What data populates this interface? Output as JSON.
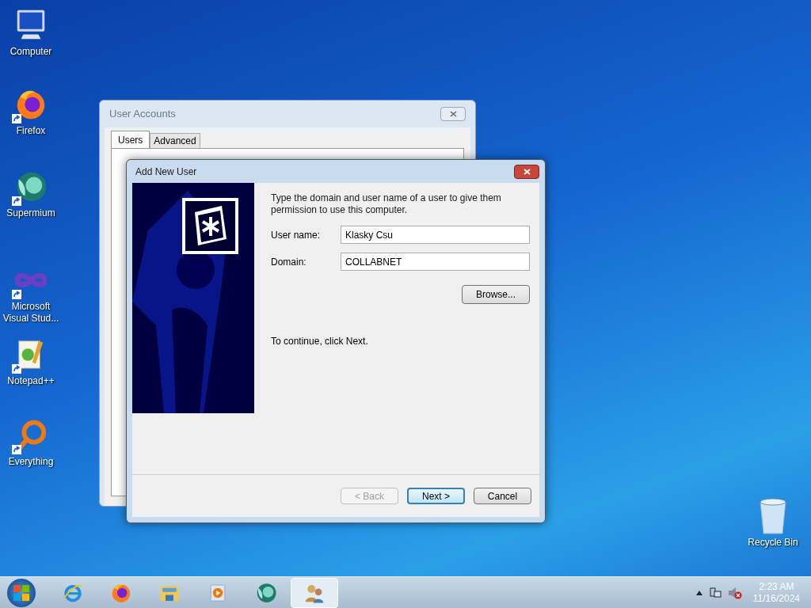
{
  "desktop_icons": [
    {
      "label": "Computer",
      "kind": "computer"
    },
    {
      "label": "Firefox",
      "kind": "firefox"
    },
    {
      "label": "Supermium",
      "kind": "supermium"
    },
    {
      "label": "Microsoft Visual Stud...",
      "kind": "visualstudio"
    },
    {
      "label": "Notepad++",
      "kind": "notepad"
    },
    {
      "label": "Everything",
      "kind": "everything"
    }
  ],
  "recycle_bin": {
    "label": "Recycle Bin"
  },
  "background_window": {
    "title": "User Accounts",
    "tabs": [
      {
        "label": "Users",
        "selected": true
      },
      {
        "label": "Advanced",
        "selected": false
      }
    ]
  },
  "dialog": {
    "title": "Add New User",
    "instructions": "Type the domain and user name of a user to give them permission to use this computer.",
    "fields": [
      {
        "label": "User name:",
        "value": "Klasky Csu"
      },
      {
        "label": "Domain:",
        "value": "COLLABNET"
      }
    ],
    "browse_button": "Browse...",
    "continue_text": "To continue, click Next.",
    "buttons": [
      {
        "label": "< Back",
        "disabled": true,
        "default": false
      },
      {
        "label": "Next >",
        "disabled": false,
        "default": true
      },
      {
        "label": "Cancel",
        "disabled": false,
        "default": false
      }
    ]
  },
  "taskbar": {
    "items": [
      {
        "kind": "ie",
        "selected": false
      },
      {
        "kind": "firefox",
        "selected": false
      },
      {
        "kind": "explorer",
        "selected": false
      },
      {
        "kind": "mediaplayer",
        "selected": false
      },
      {
        "kind": "supermium",
        "selected": false
      },
      {
        "kind": "users",
        "selected": true
      }
    ],
    "clock": {
      "time": "2:23 AM",
      "date": "11/16/2024"
    }
  }
}
